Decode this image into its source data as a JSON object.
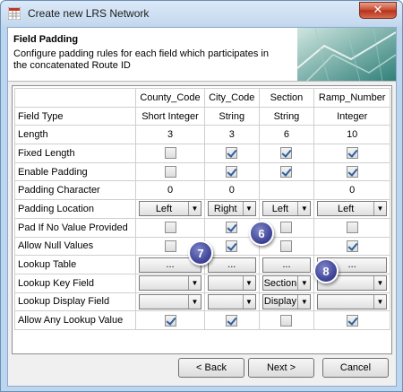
{
  "window": {
    "title": "Create new LRS Network",
    "close_glyph": "✕"
  },
  "header": {
    "title": "Field Padding",
    "description": "Configure padding rules for each field which participates in the concatenated Route ID"
  },
  "columns": [
    "County_Code",
    "City_Code",
    "Section",
    "Ramp_Number"
  ],
  "rows": {
    "field_type": {
      "label": "Field Type",
      "values": [
        "Short Integer",
        "String",
        "String",
        "Integer"
      ]
    },
    "length": {
      "label": "Length",
      "values": [
        "3",
        "3",
        "6",
        "10"
      ]
    },
    "fixed_length": {
      "label": "Fixed Length",
      "checked": [
        false,
        true,
        true,
        true
      ]
    },
    "enable_padding": {
      "label": "Enable Padding",
      "checked": [
        false,
        true,
        true,
        true
      ]
    },
    "padding_character": {
      "label": "Padding Character",
      "values": [
        "0",
        "0",
        "",
        "0"
      ]
    },
    "padding_location": {
      "label": "Padding Location",
      "values": [
        "Left",
        "Right",
        "Left",
        "Left"
      ]
    },
    "pad_if_no_value": {
      "label": "Pad If No Value Provided",
      "checked": [
        false,
        true,
        false,
        false
      ]
    },
    "allow_null": {
      "label": "Allow Null Values",
      "checked": [
        false,
        true,
        false,
        true
      ]
    },
    "lookup_table": {
      "label": "Lookup Table",
      "button_label": "..."
    },
    "lookup_key_field": {
      "label": "Lookup Key Field",
      "values": [
        "",
        "",
        "Section",
        ""
      ]
    },
    "lookup_display_field": {
      "label": "Lookup Display Field",
      "values": [
        "",
        "",
        "Display",
        ""
      ]
    },
    "allow_any_lookup": {
      "label": "Allow Any Lookup Value",
      "checked": [
        true,
        true,
        false,
        true
      ]
    }
  },
  "callouts": [
    "6",
    "7",
    "8"
  ],
  "buttons": {
    "back": "< Back",
    "next": "Next >",
    "cancel": "Cancel"
  },
  "icons": {
    "dropdown_arrow": "▼"
  }
}
